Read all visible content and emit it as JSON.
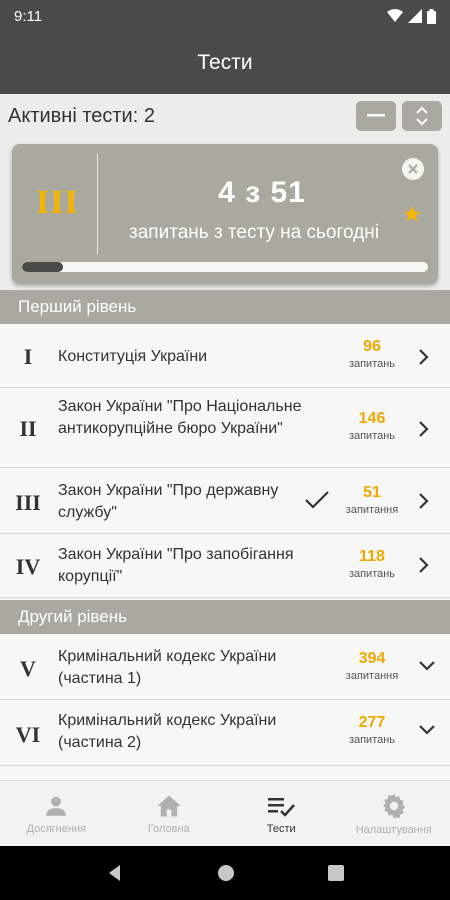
{
  "status": {
    "time": "9:11"
  },
  "header": {
    "title": "Тести"
  },
  "active": {
    "label": "Активні тести: 2"
  },
  "today": {
    "roman": "III",
    "count": "4 з 51",
    "subtitle": "запитань з тесту на сьогодні",
    "progress": 0.1
  },
  "sections": [
    {
      "title": "Перший рівень"
    },
    {
      "title": "Другий рівень"
    }
  ],
  "items": [
    {
      "roman": "I",
      "name": "Конституція України",
      "count": "96",
      "unit": "запитань",
      "arrow": "right"
    },
    {
      "roman": "II",
      "name": "Закон України \"Про Національне антикорупційне бюро України\"",
      "count": "146",
      "unit": "запитань",
      "arrow": "right"
    },
    {
      "roman": "III",
      "name": "Закон України \"Про державну службу\"",
      "count": "51",
      "unit": "запитання",
      "arrow": "right",
      "checked": true
    },
    {
      "roman": "IV",
      "name": "Закон України \"Про запобігання корупції\"",
      "count": "118",
      "unit": "запитань",
      "arrow": "right"
    },
    {
      "roman": "V",
      "name": "Кримінальний кодекс України (частина 1)",
      "count": "394",
      "unit": "запитання",
      "arrow": "down"
    },
    {
      "roman": "VI",
      "name": "Кримінальний кодекс України (частина 2)",
      "count": "277",
      "unit": "запитань",
      "arrow": "down"
    }
  ],
  "nav": [
    {
      "label": "Досягнення",
      "icon": "person-icon"
    },
    {
      "label": "Головна",
      "icon": "home-icon"
    },
    {
      "label": "Тести",
      "icon": "checklist-icon",
      "active": true
    },
    {
      "label": "Налаштування",
      "icon": "gear-icon"
    }
  ],
  "colors": {
    "accent": "#f0a800",
    "bar": "#4a4a48",
    "section": "#a9a9a1"
  }
}
